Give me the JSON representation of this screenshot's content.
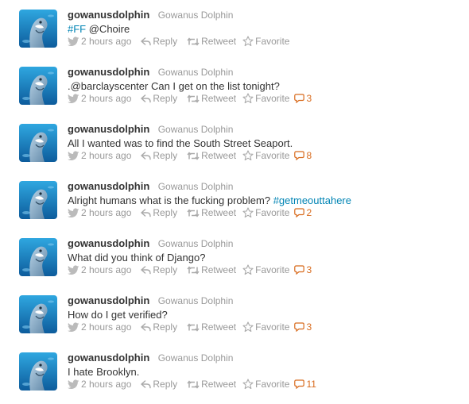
{
  "timeline": {
    "tweets": [
      {
        "username": "gowanusdolphin",
        "fullname": "Gowanus Dolphin",
        "text_parts": [
          {
            "text": "#FF",
            "link": true
          },
          {
            "text": " @Choire",
            "link": false
          }
        ],
        "time": "2 hours ago",
        "reply": "Reply",
        "retweet": "Retweet",
        "favorite": "Favorite",
        "replies": ""
      },
      {
        "username": "gowanusdolphin",
        "fullname": "Gowanus Dolphin",
        "text_parts": [
          {
            "text": ".@barclayscenter Can I get on the list tonight?",
            "link": false
          }
        ],
        "time": "2 hours ago",
        "reply": "Reply",
        "retweet": "Retweet",
        "favorite": "Favorite",
        "replies": "3"
      },
      {
        "username": "gowanusdolphin",
        "fullname": "Gowanus Dolphin",
        "text_parts": [
          {
            "text": "All I wanted was to find the South Street Seaport.",
            "link": false
          }
        ],
        "time": "2 hours ago",
        "reply": "Reply",
        "retweet": "Retweet",
        "favorite": "Favorite",
        "replies": "8"
      },
      {
        "username": "gowanusdolphin",
        "fullname": "Gowanus Dolphin",
        "text_parts": [
          {
            "text": "Alright humans what is the fucking problem? ",
            "link": false
          },
          {
            "text": "#getmeouttahere",
            "link": true
          }
        ],
        "time": "2 hours ago",
        "reply": "Reply",
        "retweet": "Retweet",
        "favorite": "Favorite",
        "replies": "2"
      },
      {
        "username": "gowanusdolphin",
        "fullname": "Gowanus Dolphin",
        "text_parts": [
          {
            "text": "What did you think of Django?",
            "link": false
          }
        ],
        "time": "2 hours ago",
        "reply": "Reply",
        "retweet": "Retweet",
        "favorite": "Favorite",
        "replies": "3"
      },
      {
        "username": "gowanusdolphin",
        "fullname": "Gowanus Dolphin",
        "text_parts": [
          {
            "text": "How do I get verified?",
            "link": false
          }
        ],
        "time": "2 hours ago",
        "reply": "Reply",
        "retweet": "Retweet",
        "favorite": "Favorite",
        "replies": "3"
      },
      {
        "username": "gowanusdolphin",
        "fullname": "Gowanus Dolphin",
        "text_parts": [
          {
            "text": "I hate Brooklyn.",
            "link": false
          }
        ],
        "time": "2 hours ago",
        "reply": "Reply",
        "retweet": "Retweet",
        "favorite": "Favorite",
        "replies": "11"
      }
    ]
  },
  "icons": {
    "avatar": "dolphin-photo",
    "time": "bird-icon",
    "reply": "reply-arrow-icon",
    "retweet": "retweet-icon",
    "favorite": "star-outline-icon",
    "replies": "speech-bubble-icon"
  },
  "colors": {
    "username": "#333333",
    "fullname": "#999999",
    "text": "#333333",
    "link": "#0084b4",
    "meta": "#999999",
    "reply_count": "#d86a1c"
  }
}
